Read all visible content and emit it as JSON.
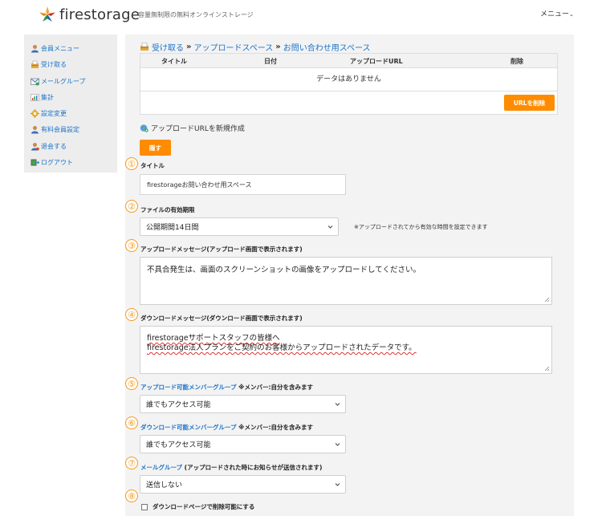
{
  "header": {
    "logo_text": "firestorage",
    "tagline": "容量無制限の無料オンラインストレージ",
    "menu_label": "メニュー",
    "brand_colors": [
      "#f39a1f",
      "#e8432b",
      "#3aa655",
      "#2a7fd4"
    ]
  },
  "sidebar": {
    "items": [
      {
        "label": "会員メニュー",
        "icon": "person-icon"
      },
      {
        "label": "受け取る",
        "icon": "inbox-icon"
      },
      {
        "label": "メールグループ",
        "icon": "mail-icon"
      },
      {
        "label": "集計",
        "icon": "chart-icon"
      },
      {
        "label": "設定変更",
        "icon": "gear-icon"
      },
      {
        "label": "有料会員設定",
        "icon": "person-icon"
      },
      {
        "label": "退会する",
        "icon": "person-icon"
      },
      {
        "label": "ログアウト",
        "icon": "logout-icon"
      }
    ]
  },
  "breadcrumb": {
    "items": [
      "受け取る",
      "アップロードスペース",
      "お問い合わせ用スペース"
    ],
    "separator": "»"
  },
  "url_table": {
    "columns": [
      "タイトル",
      "日付",
      "アップロードURL",
      "削除"
    ],
    "empty_text": "データはありません",
    "delete_button": "URLを削除"
  },
  "new_url": {
    "label": "アップロードURLを新規作成",
    "hide_button": "隠す"
  },
  "form": {
    "title": {
      "num": "①",
      "label": "タイトル",
      "value": "firestorageお問い合わせ用スペース"
    },
    "expiry": {
      "num": "②",
      "label": "ファイルの有効期限",
      "value": "公開期間14日間",
      "hint": "※アップロードされてから有効な時間を設定できます"
    },
    "upload_message": {
      "num": "③",
      "label": "アップロードメッセージ(アップロード画面で表示されます)",
      "value": "不具合発生は、画面のスクリーンショットの画像をアップロードしてください。"
    },
    "download_message": {
      "num": "④",
      "label": "ダウンロードメッセージ(ダウンロード画面で表示されます)",
      "line1": "firestorageサポートスタッフの皆様へ",
      "line2": "firestorage法人プランをご契約のお客様からアップロードされたデータです。"
    },
    "upload_group": {
      "num": "⑤",
      "label_link": "アップロード可能メンバーグループ",
      "label_note": " ※メンバー:自分を含みます",
      "value": "誰でもアクセス可能"
    },
    "download_group": {
      "num": "⑥",
      "label_link": "ダウンロード可能メンバーグループ",
      "label_note": " ※メンバー:自分を含みます",
      "value": "誰でもアクセス可能"
    },
    "mail_group": {
      "num": "⑦",
      "label_link": "メールグループ",
      "label_note": " (アップロードされた時にお知らせが送信されます)",
      "value": "送信しない"
    },
    "delete_option": {
      "num": "⑧",
      "label": "ダウンロードページで削除可能にする"
    }
  }
}
